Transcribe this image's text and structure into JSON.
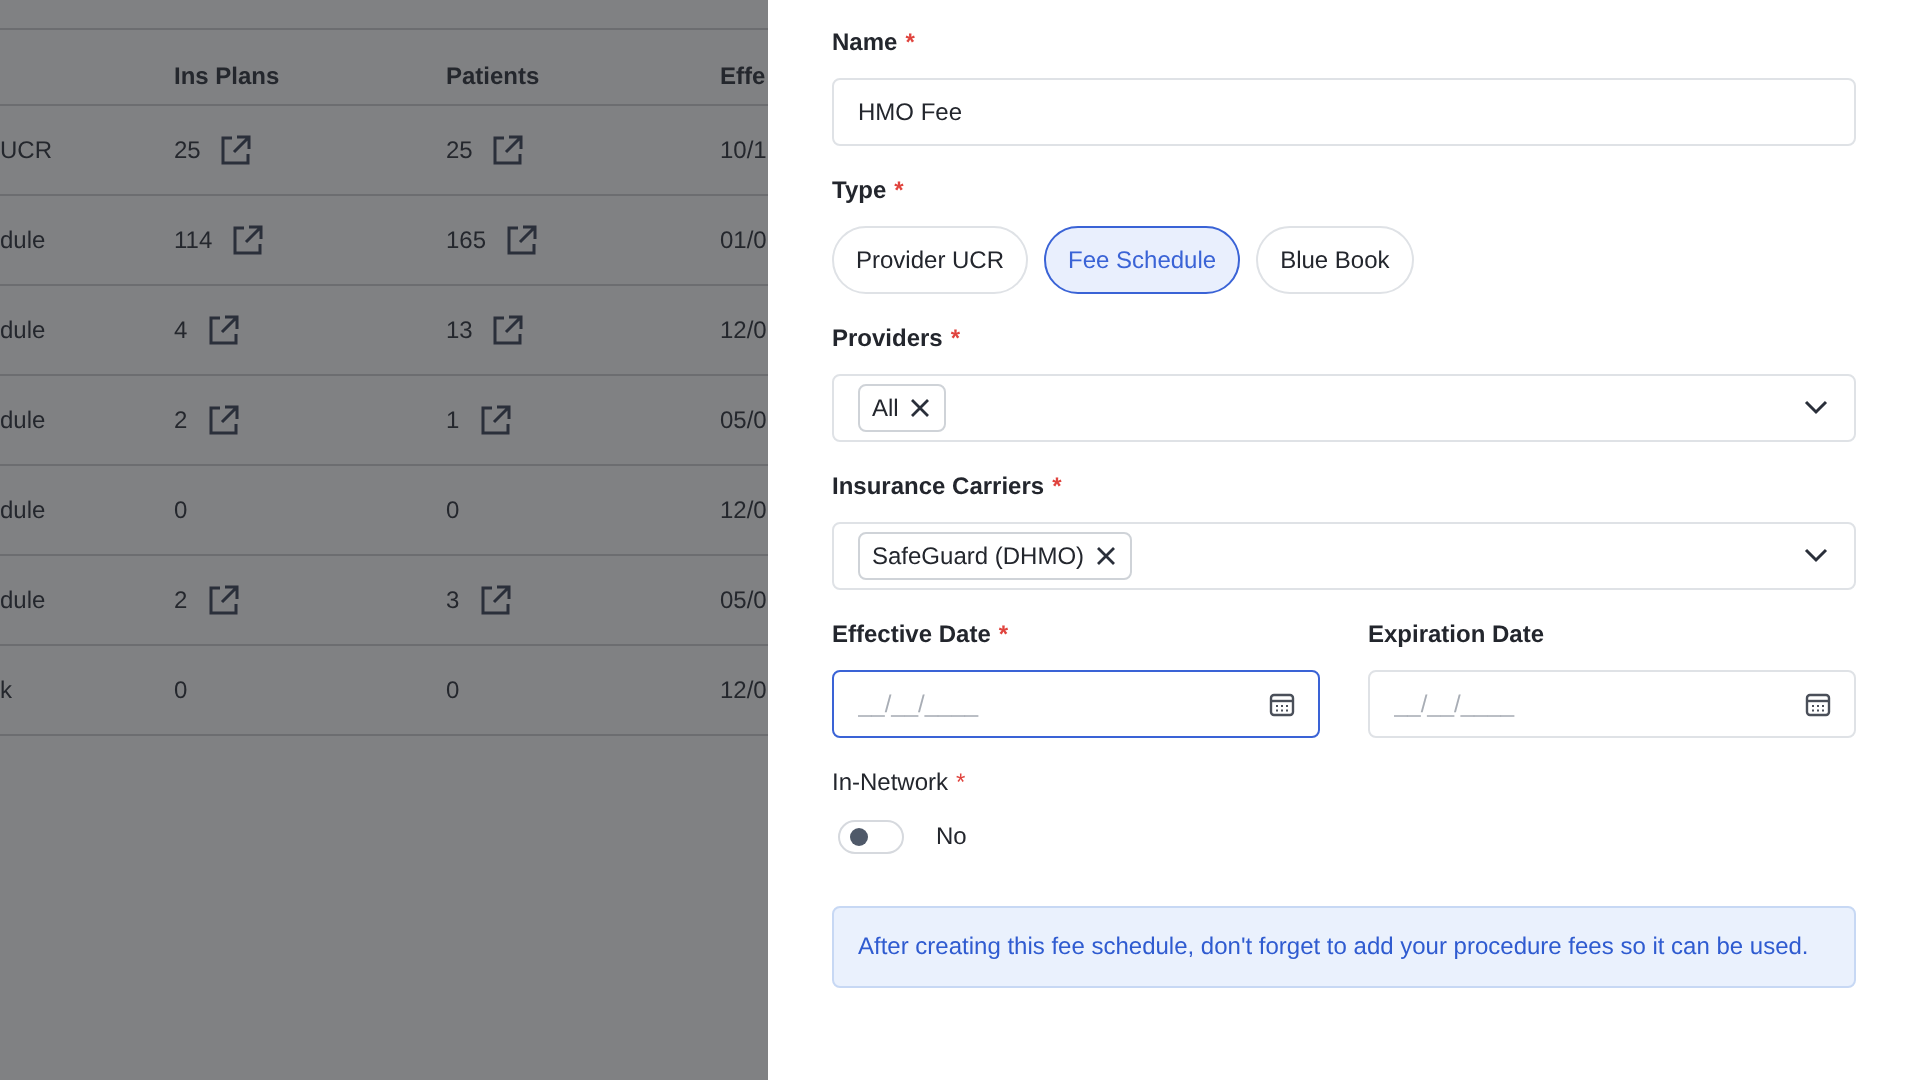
{
  "table": {
    "columns": [
      "Ins Plans",
      "Patients",
      "Effe"
    ],
    "rows": [
      {
        "column_1": "UCR",
        "ins_plans": "25",
        "ins_plans_link": true,
        "patients": "25",
        "patients_link": true,
        "effective": "10/1"
      },
      {
        "column_1": "dule",
        "ins_plans": "114",
        "ins_plans_link": true,
        "patients": "165",
        "patients_link": true,
        "effective": "01/0"
      },
      {
        "column_1": "dule",
        "ins_plans": "4",
        "ins_plans_link": true,
        "patients": "13",
        "patients_link": true,
        "effective": "12/0"
      },
      {
        "column_1": "dule",
        "ins_plans": "2",
        "ins_plans_link": true,
        "patients": "1",
        "patients_link": true,
        "effective": "05/0"
      },
      {
        "column_1": "dule",
        "ins_plans": "0",
        "ins_plans_link": false,
        "patients": "0",
        "patients_link": false,
        "effective": "12/0"
      },
      {
        "column_1": "dule",
        "ins_plans": "2",
        "ins_plans_link": true,
        "patients": "3",
        "patients_link": true,
        "effective": "05/0"
      },
      {
        "column_1": "k",
        "ins_plans": "0",
        "ins_plans_link": false,
        "patients": "0",
        "patients_link": false,
        "effective": "12/0"
      }
    ]
  },
  "form": {
    "name": {
      "label": "Name",
      "required_mark": "*",
      "value": "HMO Fee"
    },
    "type": {
      "label": "Type",
      "required_mark": "*",
      "options": [
        {
          "label": "Provider UCR",
          "selected": false
        },
        {
          "label": "Fee Schedule",
          "selected": true
        },
        {
          "label": "Blue Book",
          "selected": false
        }
      ]
    },
    "providers": {
      "label": "Providers",
      "required_mark": "*",
      "chips": [
        "All"
      ]
    },
    "insurance_carriers": {
      "label": "Insurance Carriers",
      "required_mark": "*",
      "chips": [
        "SafeGuard (DHMO)"
      ]
    },
    "dates": [
      {
        "label": "Effective Date",
        "required_mark": "*",
        "placeholder": "__/__/____",
        "focused": true
      },
      {
        "label": "Expiration Date",
        "placeholder": "__/__/____",
        "focused": false
      }
    ],
    "in_network": {
      "label": "In-Network",
      "required_mark": "*",
      "on": false,
      "text": "No"
    },
    "info": "After creating this fee schedule, don't forget to add your procedure fees so it can be used."
  }
}
